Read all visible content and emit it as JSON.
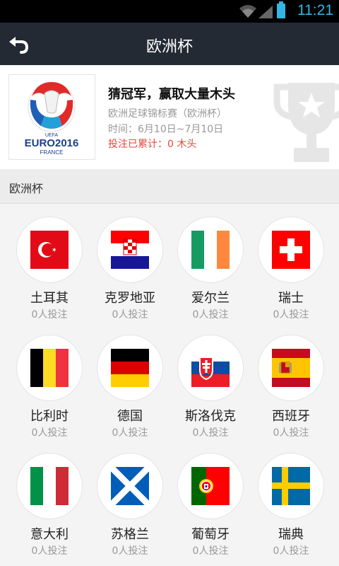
{
  "status": {
    "time": "11:21"
  },
  "appbar": {
    "title": "欧洲杯"
  },
  "hero": {
    "headline": "猜冠军，赢取大量木头",
    "subtitle": "欧洲足球锦标赛（欧洲杯）",
    "date": "时间：6月10日~7月10日",
    "bet_total": "投注已累计：0 木头",
    "logo_text": {
      "uefa": "UEFA",
      "euro": "EURO2016",
      "country": "FRANCE"
    }
  },
  "section": {
    "title": "欧洲杯"
  },
  "teams": [
    {
      "name": "土耳其",
      "count": "0人投注",
      "flag": "turkey-flag"
    },
    {
      "name": "克罗地亚",
      "count": "0人投注",
      "flag": "croatia-flag"
    },
    {
      "name": "爱尔兰",
      "count": "0人投注",
      "flag": "ireland-flag"
    },
    {
      "name": "瑞士",
      "count": "0人投注",
      "flag": "switzerland-flag"
    },
    {
      "name": "比利时",
      "count": "0人投注",
      "flag": "belgium-flag"
    },
    {
      "name": "德国",
      "count": "0人投注",
      "flag": "germany-flag"
    },
    {
      "name": "斯洛伐克",
      "count": "0人投注",
      "flag": "slovakia-flag"
    },
    {
      "name": "西班牙",
      "count": "0人投注",
      "flag": "spain-flag"
    },
    {
      "name": "意大利",
      "count": "0人投注",
      "flag": "italy-flag"
    },
    {
      "name": "苏格兰",
      "count": "0人投注",
      "flag": "scotland-flag"
    },
    {
      "name": "葡萄牙",
      "count": "0人投注",
      "flag": "portugal-flag"
    },
    {
      "name": "瑞典",
      "count": "0人投注",
      "flag": "sweden-flag"
    }
  ],
  "colors": {
    "appbar": "#232a34",
    "accent_red": "#e8483b",
    "status_blue": "#33b5e5"
  }
}
